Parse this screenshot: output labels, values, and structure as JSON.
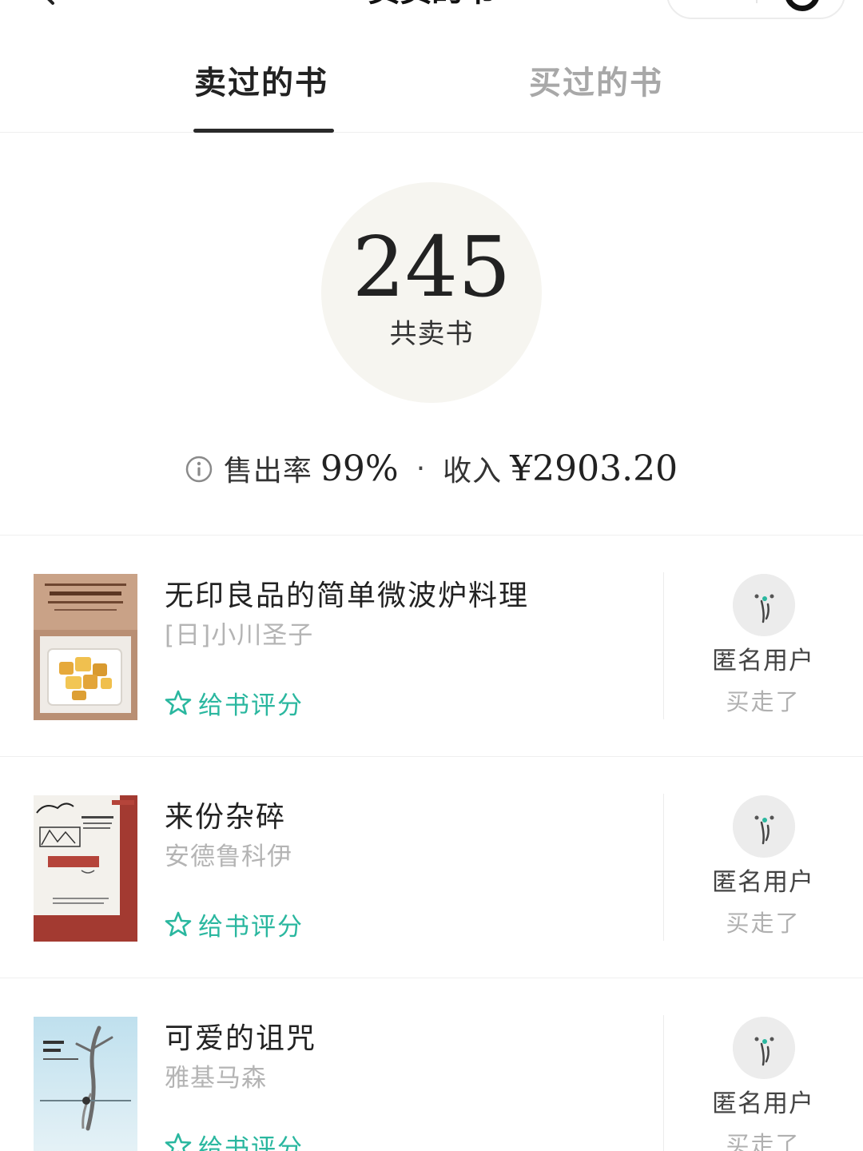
{
  "header": {
    "title": "卖卖的书"
  },
  "tabs": [
    {
      "label": "卖过的书",
      "active": true
    },
    {
      "label": "买过的书",
      "active": false
    }
  ],
  "stats": {
    "total_sold": "245",
    "total_sold_label": "共卖书",
    "sell_rate_label": "售出率",
    "sell_rate": "99%",
    "separator": "·",
    "income_label": "收入",
    "income": "¥2903.20"
  },
  "books": [
    {
      "title": "无印良品的简单微波炉料理",
      "author": "[日]小川圣子",
      "rate_label": "给书评分",
      "buyer_name": "匿名用户",
      "buyer_status": "买走了"
    },
    {
      "title": "来份杂碎",
      "author": "安德鲁科伊",
      "rate_label": "给书评分",
      "buyer_name": "匿名用户",
      "buyer_status": "买走了"
    },
    {
      "title": "可爱的诅咒",
      "author": "雅基马森",
      "rate_label": "给书评分",
      "buyer_name": "匿名用户",
      "buyer_status": "买走了"
    }
  ],
  "colors": {
    "accent": "#2ab79f",
    "circle_bg": "#f6f5f0",
    "muted_text": "#b4b4b4"
  },
  "icons": [
    "back-arrow-icon",
    "more-dots-icon",
    "close-circle-icon",
    "info-icon",
    "star-outline-icon",
    "anonymous-avatar-icon"
  ]
}
